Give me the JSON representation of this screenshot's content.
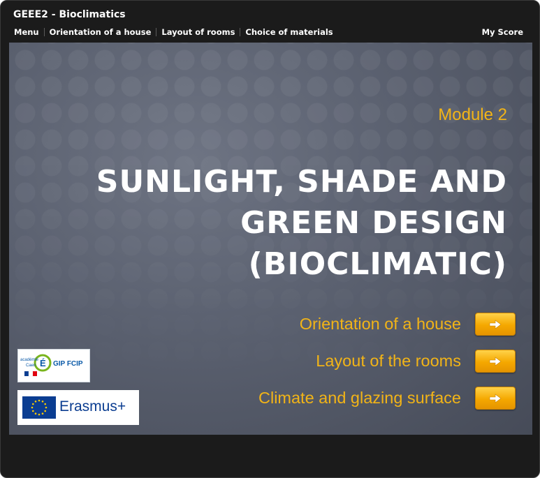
{
  "app": {
    "title": "GEEE2 - Bioclimatics"
  },
  "navbar": {
    "items": [
      "Menu",
      "Orientation of a house",
      "Layout of rooms",
      "Choice of materials"
    ],
    "score_label": "My Score"
  },
  "slide": {
    "module": "Module 2",
    "title_lines": [
      "SUNLIGHT, SHADE  AND",
      "GREEN DESIGN",
      "(BIOCLIMATIC)"
    ],
    "links": [
      {
        "label": "Orientation of a house",
        "icon": "arrow-right-icon"
      },
      {
        "label": "Layout of the rooms",
        "icon": "arrow-right-icon"
      },
      {
        "label": "Climate and glazing surface",
        "icon": "arrow-right-icon"
      }
    ]
  },
  "logos": {
    "gip": {
      "text": "GIP FCIP",
      "icon": "gip-fcip-logo"
    },
    "erasmus": {
      "text": "Erasmus+",
      "icon": "eu-flag-icon"
    }
  },
  "colors": {
    "accent": "#f2b417",
    "button": "#f5a800",
    "frame": "#1b1b1b",
    "slide_bg": "#5a606f"
  }
}
